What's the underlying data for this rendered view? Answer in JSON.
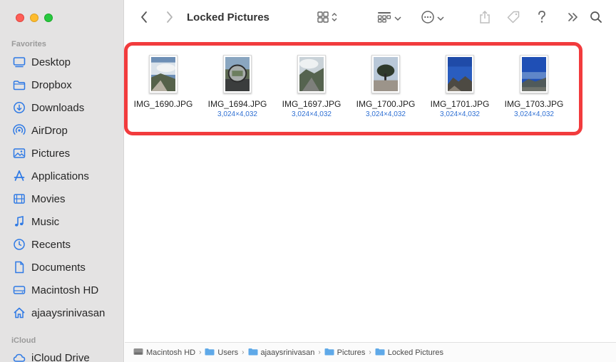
{
  "window": {
    "title": "Locked Pictures"
  },
  "sidebar": {
    "favorites_header": "Favorites",
    "icloud_header": "iCloud",
    "items": [
      {
        "label": "Desktop",
        "icon": "desktop-icon"
      },
      {
        "label": "Dropbox",
        "icon": "folder-icon"
      },
      {
        "label": "Downloads",
        "icon": "downloads-icon"
      },
      {
        "label": "AirDrop",
        "icon": "airdrop-icon"
      },
      {
        "label": "Pictures",
        "icon": "pictures-icon"
      },
      {
        "label": "Applications",
        "icon": "applications-icon"
      },
      {
        "label": "Movies",
        "icon": "movies-icon"
      },
      {
        "label": "Music",
        "icon": "music-icon"
      },
      {
        "label": "Recents",
        "icon": "recents-icon"
      },
      {
        "label": "Documents",
        "icon": "documents-icon"
      },
      {
        "label": "Macintosh HD",
        "icon": "disk-icon"
      },
      {
        "label": "ajaaysrinivasan",
        "icon": "home-icon"
      }
    ],
    "icloud_items": [
      {
        "label": "iCloud Drive",
        "icon": "cloud-icon"
      }
    ]
  },
  "files": [
    {
      "name": "IMG_1690.JPG",
      "dims": ""
    },
    {
      "name": "IMG_1694.JPG",
      "dims": "3,024×4,032"
    },
    {
      "name": "IMG_1697.JPG",
      "dims": "3,024×4,032"
    },
    {
      "name": "IMG_1700.JPG",
      "dims": "3,024×4,032"
    },
    {
      "name": "IMG_1701.JPG",
      "dims": "3,024×4,032"
    },
    {
      "name": "IMG_1703.JPG",
      "dims": "3,024×4,032"
    }
  ],
  "pathbar": {
    "segments": [
      "Macintosh HD",
      "Users",
      "ajaaysrinivasan",
      "Pictures",
      "Locked Pictures"
    ]
  },
  "colors": {
    "accent": "#2e6fd3",
    "highlight": "#f23b3d",
    "sidebar_bg": "#e4e3e3"
  }
}
